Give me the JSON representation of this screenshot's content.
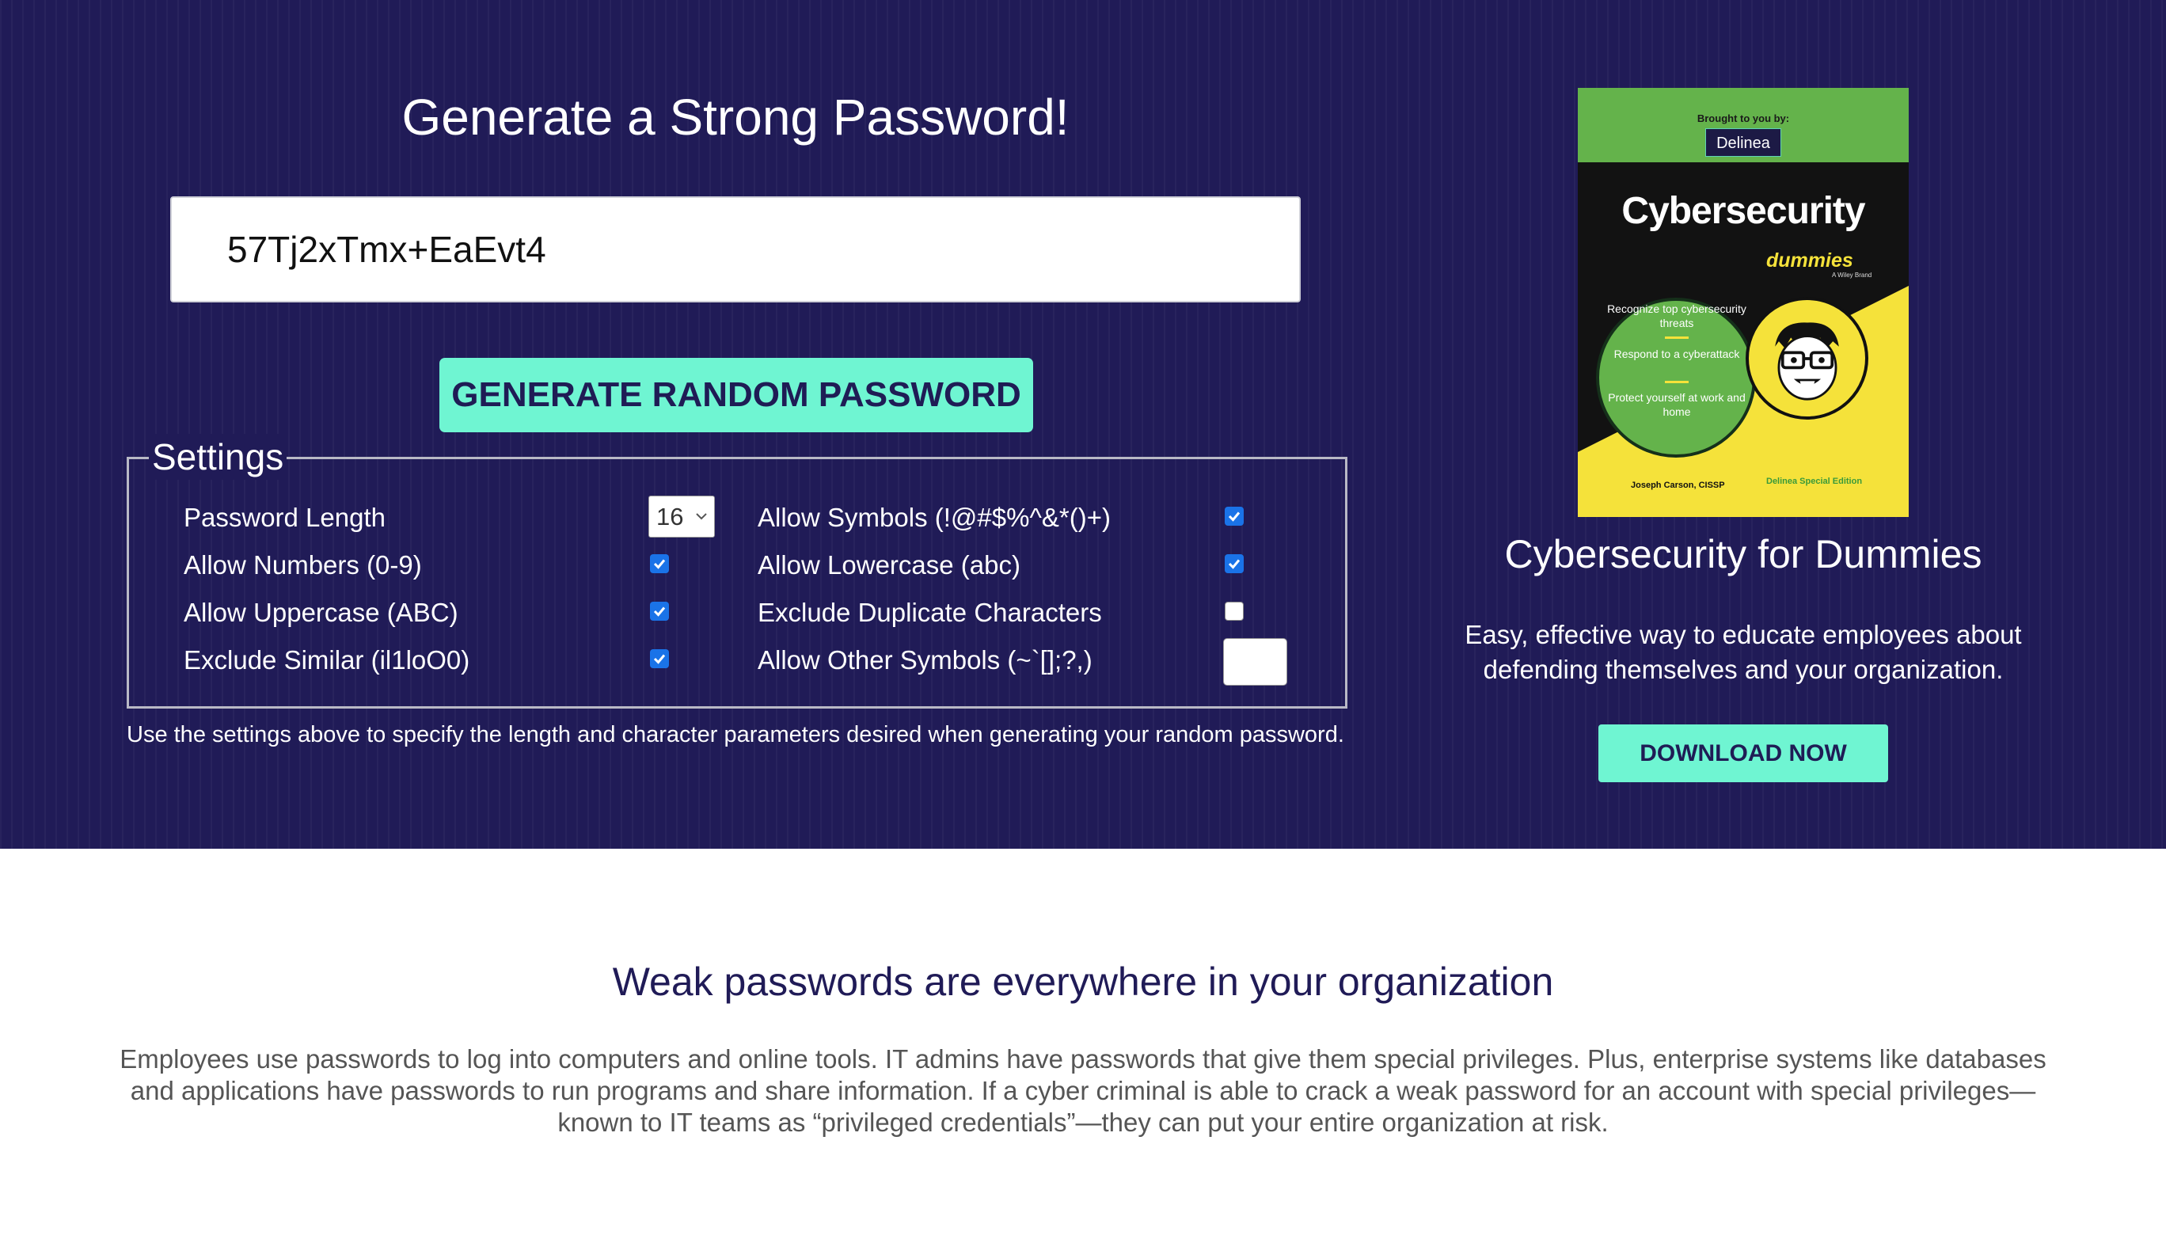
{
  "hero": {
    "title": "Generate a Strong Password!",
    "password_value": "57Tj2xTmx+EaEvt4",
    "generate_button": "GENERATE RANDOM PASSWORD",
    "settings": {
      "legend": "Settings",
      "password_length_label": "Password Length",
      "password_length_value": "16",
      "options_left": [
        {
          "label": "Allow Numbers (0-9)",
          "checked": true
        },
        {
          "label": "Allow Uppercase (ABC)",
          "checked": true
        },
        {
          "label": "Exclude Similar (il1loO0)",
          "checked": true
        }
      ],
      "options_right": [
        {
          "label": "Allow Symbols (!@#$%^&*()+)",
          "checked": true
        },
        {
          "label": "Allow Lowercase (abc)",
          "checked": true
        },
        {
          "label": "Exclude Duplicate Characters",
          "checked": false
        }
      ],
      "other_symbols_label": "Allow Other Symbols (~`[];?,)",
      "other_symbols_value": ""
    },
    "hint": "Use the settings above to specify the length and character parameters desired when generating your random password."
  },
  "promo": {
    "book": {
      "brought_by": "Brought to you by:",
      "brand": "Delinea",
      "title": "Cybersecurity",
      "series": "dummies",
      "publisher": "A Wiley Brand",
      "bullets": [
        "Recognize top cybersecurity threats",
        "Respond to a cyberattack",
        "Protect yourself at work and home"
      ],
      "author": "Joseph Carson, CISSP",
      "edition": "Delinea Special Edition"
    },
    "title": "Cybersecurity for Dummies",
    "description": "Easy, effective way to educate employees about defending themselves and your organization.",
    "button": "DOWNLOAD NOW"
  },
  "section": {
    "title": "Weak passwords are everywhere in your organization",
    "body": "Employees use passwords to log into computers and online tools. IT admins have passwords that give them special privileges. Plus, enterprise systems like databases and applications have passwords to run programs and share information. If a cyber criminal is able to crack a weak password for an account with special privileges—known to IT teams as “privileged credentials”—they can put your entire organization at risk."
  },
  "colors": {
    "hero_bg": "#201b57",
    "accent": "#6ff5d2",
    "checkbox": "#1a73e8"
  }
}
